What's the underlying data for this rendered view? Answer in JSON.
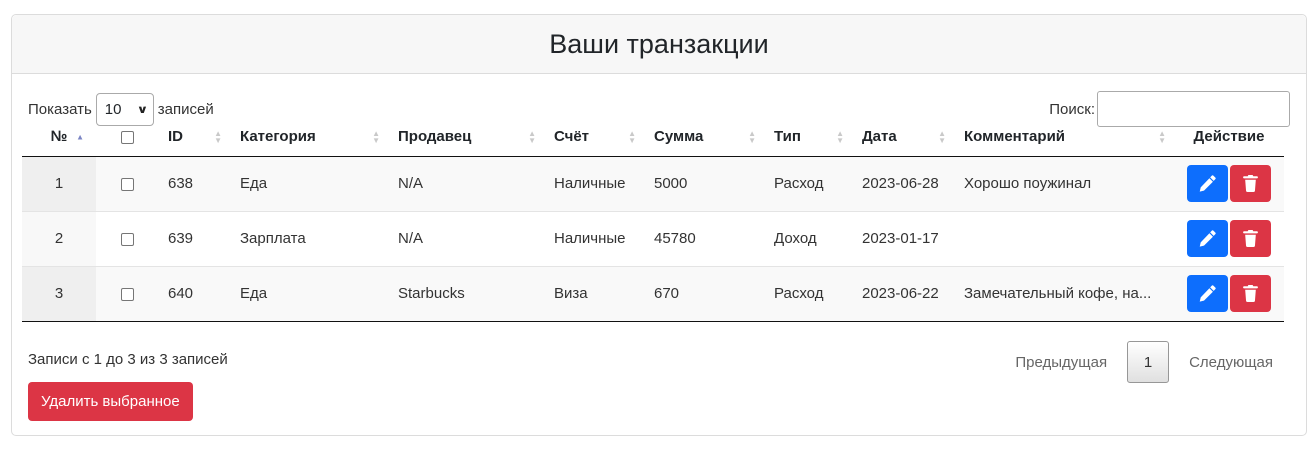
{
  "card": {
    "title": "Ваши транзакции"
  },
  "controls": {
    "show_label": "Показать",
    "page_size": "10",
    "entries_label": "записей",
    "search_label": "Поиск:",
    "search_value": ""
  },
  "table": {
    "headers": [
      "№",
      "",
      "ID",
      "Категория",
      "Продавец",
      "Счёт",
      "Сумма",
      "Тип",
      "Дата",
      "Комментарий",
      "Действие"
    ],
    "rows": [
      {
        "num": "1",
        "id": "638",
        "category": "Еда",
        "vendor": "N/A",
        "account": "Наличные",
        "amount": "5000",
        "type": "Расход",
        "date": "2023-06-28",
        "comment": "Хорошо поужинал"
      },
      {
        "num": "2",
        "id": "639",
        "category": "Зарплата",
        "vendor": "N/A",
        "account": "Наличные",
        "amount": "45780",
        "type": "Доход",
        "date": "2023-01-17",
        "comment": ""
      },
      {
        "num": "3",
        "id": "640",
        "category": "Еда",
        "vendor": "Starbucks",
        "account": "Виза",
        "amount": "670",
        "type": "Расход",
        "date": "2023-06-22",
        "comment": "Замечательный кофе, на..."
      }
    ]
  },
  "footer": {
    "info": "Записи с 1 до 3 из 3 записей",
    "prev": "Предыдущая",
    "current_page": "1",
    "next": "Следующая",
    "delete_selected": "Удалить выбранное"
  },
  "icons": {
    "edit": "pencil-icon",
    "delete": "trash-icon",
    "sort": "sort-arrows-icon"
  },
  "colors": {
    "primary": "#0d6efd",
    "danger": "#dc3545"
  }
}
